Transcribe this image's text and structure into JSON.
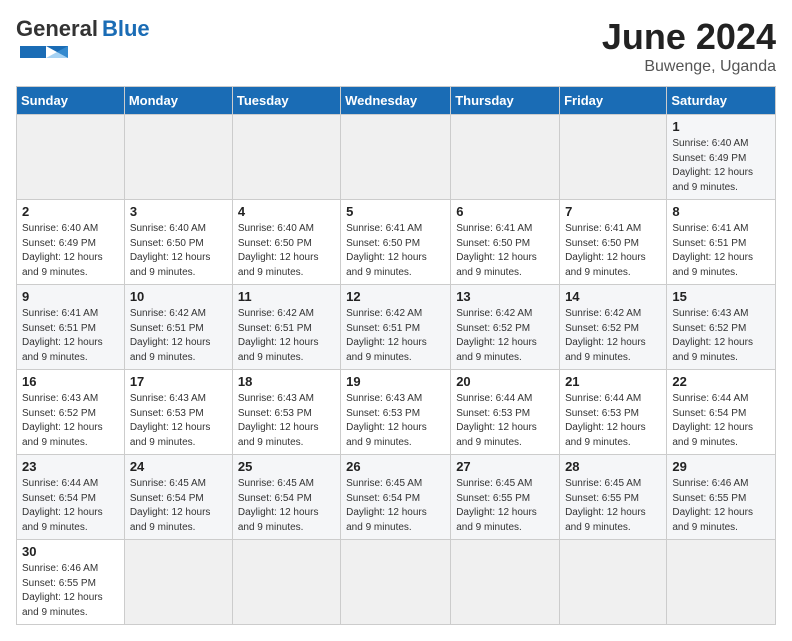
{
  "header": {
    "logo_text_general": "General",
    "logo_text_blue": "Blue",
    "month_title": "June 2024",
    "location": "Buwenge, Uganda"
  },
  "weekdays": [
    "Sunday",
    "Monday",
    "Tuesday",
    "Wednesday",
    "Thursday",
    "Friday",
    "Saturday"
  ],
  "weeks": [
    [
      {
        "day": "",
        "info": ""
      },
      {
        "day": "",
        "info": ""
      },
      {
        "day": "",
        "info": ""
      },
      {
        "day": "",
        "info": ""
      },
      {
        "day": "",
        "info": ""
      },
      {
        "day": "",
        "info": ""
      },
      {
        "day": "1",
        "info": "Sunrise: 6:40 AM\nSunset: 6:49 PM\nDaylight: 12 hours and 9 minutes."
      }
    ],
    [
      {
        "day": "2",
        "info": "Sunrise: 6:40 AM\nSunset: 6:49 PM\nDaylight: 12 hours and 9 minutes."
      },
      {
        "day": "3",
        "info": "Sunrise: 6:40 AM\nSunset: 6:50 PM\nDaylight: 12 hours and 9 minutes."
      },
      {
        "day": "4",
        "info": "Sunrise: 6:40 AM\nSunset: 6:50 PM\nDaylight: 12 hours and 9 minutes."
      },
      {
        "day": "5",
        "info": "Sunrise: 6:41 AM\nSunset: 6:50 PM\nDaylight: 12 hours and 9 minutes."
      },
      {
        "day": "6",
        "info": "Sunrise: 6:41 AM\nSunset: 6:50 PM\nDaylight: 12 hours and 9 minutes."
      },
      {
        "day": "7",
        "info": "Sunrise: 6:41 AM\nSunset: 6:50 PM\nDaylight: 12 hours and 9 minutes."
      },
      {
        "day": "8",
        "info": "Sunrise: 6:41 AM\nSunset: 6:51 PM\nDaylight: 12 hours and 9 minutes."
      }
    ],
    [
      {
        "day": "9",
        "info": "Sunrise: 6:41 AM\nSunset: 6:51 PM\nDaylight: 12 hours and 9 minutes."
      },
      {
        "day": "10",
        "info": "Sunrise: 6:42 AM\nSunset: 6:51 PM\nDaylight: 12 hours and 9 minutes."
      },
      {
        "day": "11",
        "info": "Sunrise: 6:42 AM\nSunset: 6:51 PM\nDaylight: 12 hours and 9 minutes."
      },
      {
        "day": "12",
        "info": "Sunrise: 6:42 AM\nSunset: 6:51 PM\nDaylight: 12 hours and 9 minutes."
      },
      {
        "day": "13",
        "info": "Sunrise: 6:42 AM\nSunset: 6:52 PM\nDaylight: 12 hours and 9 minutes."
      },
      {
        "day": "14",
        "info": "Sunrise: 6:42 AM\nSunset: 6:52 PM\nDaylight: 12 hours and 9 minutes."
      },
      {
        "day": "15",
        "info": "Sunrise: 6:43 AM\nSunset: 6:52 PM\nDaylight: 12 hours and 9 minutes."
      }
    ],
    [
      {
        "day": "16",
        "info": "Sunrise: 6:43 AM\nSunset: 6:52 PM\nDaylight: 12 hours and 9 minutes."
      },
      {
        "day": "17",
        "info": "Sunrise: 6:43 AM\nSunset: 6:53 PM\nDaylight: 12 hours and 9 minutes."
      },
      {
        "day": "18",
        "info": "Sunrise: 6:43 AM\nSunset: 6:53 PM\nDaylight: 12 hours and 9 minutes."
      },
      {
        "day": "19",
        "info": "Sunrise: 6:43 AM\nSunset: 6:53 PM\nDaylight: 12 hours and 9 minutes."
      },
      {
        "day": "20",
        "info": "Sunrise: 6:44 AM\nSunset: 6:53 PM\nDaylight: 12 hours and 9 minutes."
      },
      {
        "day": "21",
        "info": "Sunrise: 6:44 AM\nSunset: 6:53 PM\nDaylight: 12 hours and 9 minutes."
      },
      {
        "day": "22",
        "info": "Sunrise: 6:44 AM\nSunset: 6:54 PM\nDaylight: 12 hours and 9 minutes."
      }
    ],
    [
      {
        "day": "23",
        "info": "Sunrise: 6:44 AM\nSunset: 6:54 PM\nDaylight: 12 hours and 9 minutes."
      },
      {
        "day": "24",
        "info": "Sunrise: 6:45 AM\nSunset: 6:54 PM\nDaylight: 12 hours and 9 minutes."
      },
      {
        "day": "25",
        "info": "Sunrise: 6:45 AM\nSunset: 6:54 PM\nDaylight: 12 hours and 9 minutes."
      },
      {
        "day": "26",
        "info": "Sunrise: 6:45 AM\nSunset: 6:54 PM\nDaylight: 12 hours and 9 minutes."
      },
      {
        "day": "27",
        "info": "Sunrise: 6:45 AM\nSunset: 6:55 PM\nDaylight: 12 hours and 9 minutes."
      },
      {
        "day": "28",
        "info": "Sunrise: 6:45 AM\nSunset: 6:55 PM\nDaylight: 12 hours and 9 minutes."
      },
      {
        "day": "29",
        "info": "Sunrise: 6:46 AM\nSunset: 6:55 PM\nDaylight: 12 hours and 9 minutes."
      }
    ],
    [
      {
        "day": "30",
        "info": "Sunrise: 6:46 AM\nSunset: 6:55 PM\nDaylight: 12 hours and 9 minutes."
      },
      {
        "day": "",
        "info": ""
      },
      {
        "day": "",
        "info": ""
      },
      {
        "day": "",
        "info": ""
      },
      {
        "day": "",
        "info": ""
      },
      {
        "day": "",
        "info": ""
      },
      {
        "day": "",
        "info": ""
      }
    ]
  ]
}
